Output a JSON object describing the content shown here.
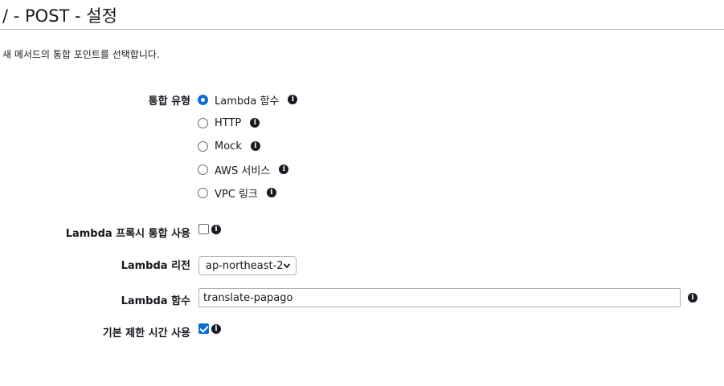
{
  "header": {
    "title": "/ - POST - 설정",
    "description": "새 메서드의 통합 포인트를 선택합니다."
  },
  "integration_type": {
    "label": "통합 유형",
    "selected": "Lambda 함수",
    "options": [
      {
        "label": "Lambda 함수",
        "checked": true
      },
      {
        "label": "HTTP",
        "checked": false
      },
      {
        "label": "Mock",
        "checked": false
      },
      {
        "label": "AWS 서비스",
        "checked": false
      },
      {
        "label": "VPC 링크",
        "checked": false
      }
    ]
  },
  "proxy_integration": {
    "label": "Lambda 프록시 통합 사용",
    "checked": false
  },
  "lambda_region": {
    "label": "Lambda 리전",
    "value": "ap-northeast-2"
  },
  "lambda_function": {
    "label": "Lambda 함수",
    "value": "translate-papago"
  },
  "default_timeout": {
    "label": "기본 제한 시간 사용",
    "checked": true
  },
  "icons": {
    "info": "info-icon",
    "dropdown": "chevron-down-icon"
  },
  "colors": {
    "accent": "#0a6cd6",
    "text": "#16191f",
    "divider": "#aab7b8"
  }
}
